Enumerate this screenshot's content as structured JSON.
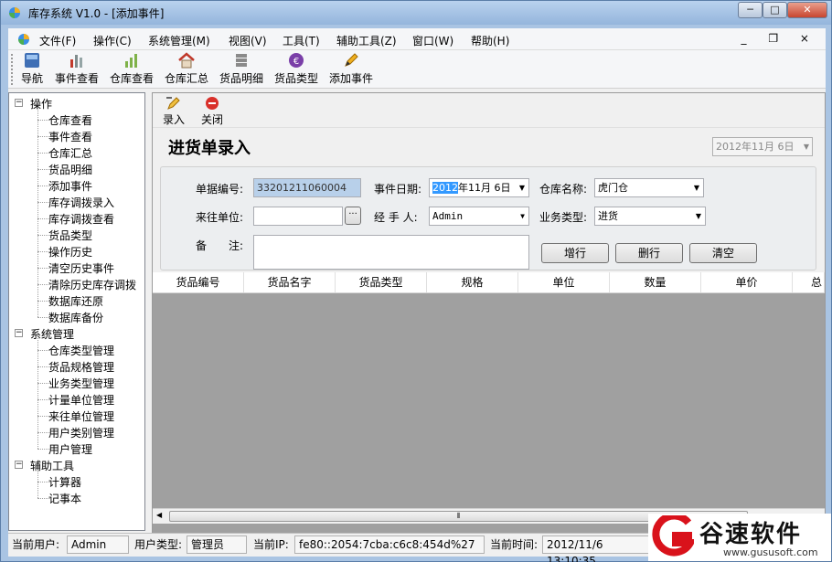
{
  "window": {
    "title": "库存系统 V1.0 - [添加事件]",
    "min": "─",
    "max": "□",
    "close": "✕"
  },
  "menu": {
    "items": [
      "文件(F)",
      "操作(C)",
      "系统管理(M)",
      "视图(V)",
      "工具(T)",
      "辅助工具(Z)",
      "窗口(W)",
      "帮助(H)"
    ],
    "mdi_controls": "_ ❐ ×"
  },
  "toolbar": {
    "items": [
      "导航",
      "事件查看",
      "仓库查看",
      "仓库汇总",
      "货品明细",
      "货品类型",
      "添加事件"
    ]
  },
  "tree": {
    "groups": [
      {
        "label": "操作",
        "children": [
          "仓库查看",
          "事件查看",
          "仓库汇总",
          "货品明细",
          "添加事件",
          "库存调拨录入",
          "库存调拨查看",
          "货品类型",
          "操作历史",
          "清空历史事件",
          "清除历史库存调拨",
          "数据库还原",
          "数据库备份"
        ]
      },
      {
        "label": "系统管理",
        "children": [
          "仓库类型管理",
          "货品规格管理",
          "业务类型管理",
          "计量单位管理",
          "来往单位管理",
          "用户类别管理",
          "用户管理"
        ]
      },
      {
        "label": "辅助工具",
        "children": [
          "计算器",
          "记事本"
        ]
      }
    ]
  },
  "subtoolbar": {
    "enter": "录入",
    "close": "关闭"
  },
  "form": {
    "title": "进货单录入",
    "top_date": "2012年11月 6日",
    "doc_no_label": "单据编号:",
    "doc_no": "33201211060004",
    "event_date_label": "事件日期:",
    "event_date_sel": "2012",
    "event_date_rest": "年11月  6日",
    "warehouse_label": "仓库名称:",
    "warehouse": "虎门仓",
    "partner_label": "来往单位:",
    "partner_value": "",
    "partner_browse": "···",
    "handler_label": "经 手 人:",
    "handler": "Admin",
    "biz_type_label": "业务类型:",
    "biz_type": "进货",
    "note_label": "备　　注:",
    "note_value": "",
    "add_row": "增行",
    "del_row": "删行",
    "clear": "清空"
  },
  "grid": {
    "columns": [
      "货品编号",
      "货品名字",
      "货品类型",
      "规格",
      "单位",
      "数量",
      "单价",
      "总"
    ]
  },
  "status": {
    "user_label": "当前用户:",
    "user": "Admin",
    "type_label": "用户类型:",
    "type": "管理员",
    "ip_label": "当前IP:",
    "ip": "fe80::2054:7cba:c6c8:454d%27",
    "time_label": "当前时间:",
    "time": "2012/11/6 13:10:35"
  },
  "watermark": {
    "brand": "谷速软件",
    "url": "www.gususoft.com"
  },
  "colors": {
    "accent": "#3399ff",
    "readonly_field": "#b8d0ea",
    "logo_red": "#d9121b"
  }
}
